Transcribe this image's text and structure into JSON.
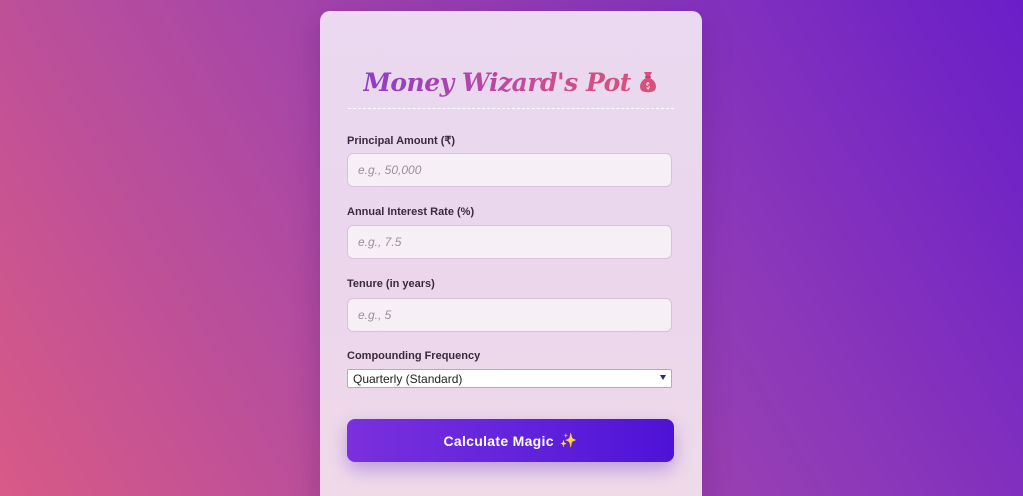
{
  "card": {
    "title": "Money Wizard's Pot",
    "title_icon": "money-bag-icon"
  },
  "form": {
    "principal": {
      "label": "Principal Amount (₹)",
      "placeholder": "e.g., 50,000",
      "value": ""
    },
    "rate": {
      "label": "Annual Interest Rate (%)",
      "placeholder": "e.g., 7.5",
      "value": ""
    },
    "tenure": {
      "label": "Tenure (in years)",
      "placeholder": "e.g., 5",
      "value": ""
    },
    "frequency": {
      "label": "Compounding Frequency",
      "selected": "Quarterly (Standard)"
    }
  },
  "button": {
    "label": "Calculate Magic",
    "icon": "sparkles-icon",
    "icon_glyph": "✨"
  },
  "colors": {
    "accent": "#6324dc",
    "title_gradient_start": "#8a3fc8",
    "title_gradient_end": "#d8507c"
  }
}
